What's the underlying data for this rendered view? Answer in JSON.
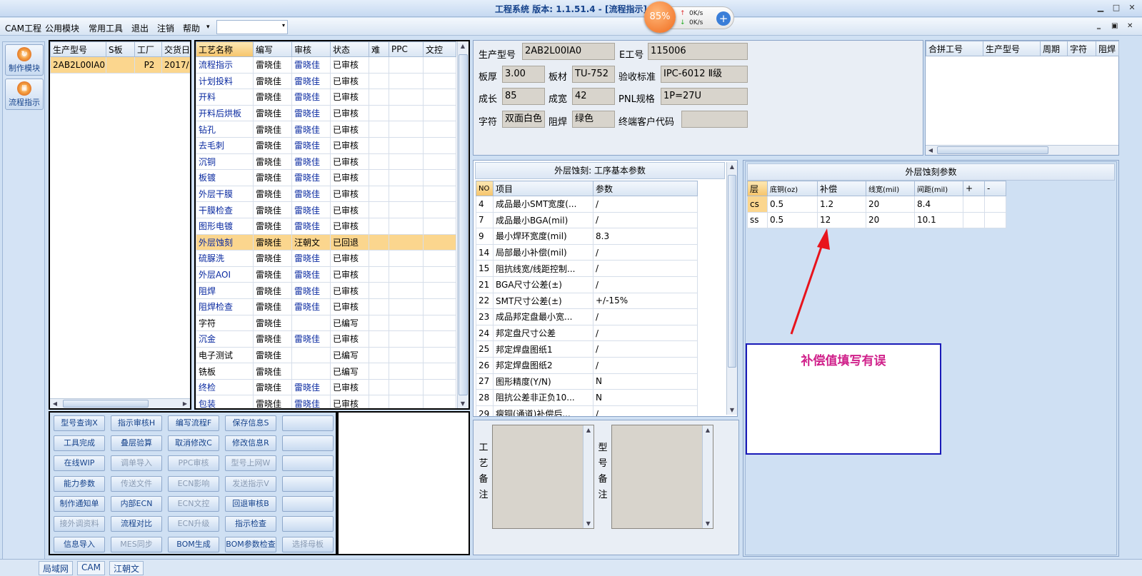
{
  "window": {
    "title": "工程系统  版本: 1.1.51.4 - [流程指示]",
    "minimize": "▁",
    "maximize": "□",
    "close": "✕"
  },
  "speed_widget": {
    "percent": "85%",
    "up_rate": "0K/s",
    "down_rate": "0K/s",
    "up_arrow": "↑",
    "down_arrow": "↓",
    "plus": "+"
  },
  "menu": {
    "items": [
      "CAM工程",
      "公用模块",
      "常用工具",
      "退出",
      "注销",
      "帮助"
    ],
    "help_arrow": "▾",
    "combo_value": "",
    "combo_arrow": "▾",
    "mdi_min": "‗",
    "mdi_restore": "▣",
    "mdi_close": "✕"
  },
  "sidebar": {
    "items": [
      {
        "label": "制作模块",
        "icon": "↻"
      },
      {
        "label": "流程指示",
        "icon": "Ⅲ"
      }
    ]
  },
  "product_table": {
    "headers": [
      "生产型号",
      "S板",
      "工厂",
      "交货日"
    ],
    "rows": [
      [
        "2AB2L00IA0",
        "",
        "P2",
        "2017/"
      ]
    ]
  },
  "process_table": {
    "headers": [
      "工艺名称",
      "编写",
      "审核",
      "状态",
      "难",
      "PPC",
      "文控"
    ],
    "rows": [
      [
        "流程指示",
        "雷晓佳",
        "雷晓佳",
        "已审核"
      ],
      [
        "计划投料",
        "雷晓佳",
        "雷晓佳",
        "已审核"
      ],
      [
        "开料",
        "雷晓佳",
        "雷晓佳",
        "已审核"
      ],
      [
        "开料后烘板",
        "雷晓佳",
        "雷晓佳",
        "已审核"
      ],
      [
        "钻孔",
        "雷晓佳",
        "雷晓佳",
        "已审核"
      ],
      [
        "去毛刺",
        "雷晓佳",
        "雷晓佳",
        "已审核"
      ],
      [
        "沉铜",
        "雷晓佳",
        "雷晓佳",
        "已审核"
      ],
      [
        "板镀",
        "雷晓佳",
        "雷晓佳",
        "已审核"
      ],
      [
        "外层干膜",
        "雷晓佳",
        "雷晓佳",
        "已审核"
      ],
      [
        "干膜检查",
        "雷晓佳",
        "雷晓佳",
        "已审核"
      ],
      [
        "图形电镀",
        "雷晓佳",
        "雷晓佳",
        "已审核"
      ],
      [
        "外层蚀刻",
        "雷晓佳",
        "汪朝文",
        "已回退"
      ],
      [
        "硫脲洗",
        "雷晓佳",
        "雷晓佳",
        "已审核"
      ],
      [
        "外层AOI",
        "雷晓佳",
        "雷晓佳",
        "已审核"
      ],
      [
        "阻焊",
        "雷晓佳",
        "雷晓佳",
        "已审核"
      ],
      [
        "阻焊检查",
        "雷晓佳",
        "雷晓佳",
        "已审核"
      ],
      [
        "字符",
        "雷晓佳",
        "",
        "已编写"
      ],
      [
        "沉金",
        "雷晓佳",
        "雷晓佳",
        "已审核"
      ],
      [
        "电子测试",
        "雷晓佳",
        "",
        "已编写"
      ],
      [
        "铣板",
        "雷晓佳",
        "",
        "已编写"
      ],
      [
        "终检",
        "雷晓佳",
        "雷晓佳",
        "已审核"
      ],
      [
        "包装",
        "雷晓佳",
        "雷晓佳",
        "已审核"
      ]
    ],
    "selected_index": 11
  },
  "action_buttons": [
    [
      {
        "label": "型号查询X",
        "enabled": true
      },
      {
        "label": "指示审核H",
        "enabled": true
      },
      {
        "label": "编写流程F",
        "enabled": true
      },
      {
        "label": "保存信息S",
        "enabled": true
      },
      {
        "label": "",
        "enabled": true
      }
    ],
    [
      {
        "label": "工具完成",
        "enabled": true
      },
      {
        "label": "叠层验算",
        "enabled": true
      },
      {
        "label": "取消修改C",
        "enabled": true
      },
      {
        "label": "修改信息R",
        "enabled": true
      },
      {
        "label": "",
        "enabled": true
      }
    ],
    [
      {
        "label": "在线WIP",
        "enabled": true
      },
      {
        "label": "调单导入",
        "enabled": false
      },
      {
        "label": "PPC审核",
        "enabled": false
      },
      {
        "label": "型号上网W",
        "enabled": false
      },
      {
        "label": "",
        "enabled": true
      }
    ],
    [
      {
        "label": "能力参数",
        "enabled": true
      },
      {
        "label": "传送文件",
        "enabled": false
      },
      {
        "label": "ECN影响",
        "enabled": false
      },
      {
        "label": "发送指示V",
        "enabled": false
      },
      {
        "label": "",
        "enabled": true
      }
    ],
    [
      {
        "label": "制作通知单",
        "enabled": true
      },
      {
        "label": "内部ECN",
        "enabled": true
      },
      {
        "label": "ECN文控",
        "enabled": false
      },
      {
        "label": "回退审核B",
        "enabled": true
      },
      {
        "label": "",
        "enabled": true
      }
    ],
    [
      {
        "label": "接外调资料",
        "enabled": false
      },
      {
        "label": "流程对比",
        "enabled": true
      },
      {
        "label": "ECN升级",
        "enabled": false
      },
      {
        "label": "指示检查",
        "enabled": true
      },
      {
        "label": "",
        "enabled": true
      }
    ],
    [
      {
        "label": "信息导入",
        "enabled": true
      },
      {
        "label": "MES同步",
        "enabled": false
      },
      {
        "label": "BOM生成",
        "enabled": true
      },
      {
        "label": "BOM参数检查",
        "enabled": true
      },
      {
        "label": "选择母板",
        "enabled": false
      }
    ]
  ],
  "info": {
    "model_label": "生产型号",
    "model_value": "2AB2L00IA0",
    "e_label": "E工号",
    "e_value": "115006",
    "thickness_label": "板厚",
    "thickness_value": "3.00",
    "material_label": "板材",
    "material_value": "TU-752",
    "accept_label": "验收标准",
    "accept_value": "IPC-6012 Ⅱ级",
    "length_label": "成长",
    "length_value": "85",
    "width_label": "成宽",
    "width_value": "42",
    "pnl_label": "PNL规格",
    "pnl_value": "1P=27U",
    "char_label": "字符",
    "char_value": "双面白色",
    "mask_label": "阻焊",
    "mask_value": "绿色",
    "customer_label": "终端客户代码",
    "customer_value": ""
  },
  "combo_table": {
    "headers": [
      "合拼工号",
      "生产型号",
      "周期",
      "字符",
      "阻焊"
    ]
  },
  "params": {
    "title": "外层蚀刻: 工序基本参数",
    "headers": [
      "NO",
      "项目",
      "参数"
    ],
    "rows": [
      [
        "4",
        "成品最小SMT宽度(...",
        "/"
      ],
      [
        "7",
        "成品最小BGA(mil)",
        "/"
      ],
      [
        "9",
        "最小焊环宽度(mil)",
        "8.3"
      ],
      [
        "14",
        "局部最小补偿(mil)",
        "/"
      ],
      [
        "15",
        "阻抗线宽/线距控制...",
        "/"
      ],
      [
        "21",
        "BGA尺寸公差(±)",
        "/"
      ],
      [
        "22",
        "SMT尺寸公差(±)",
        "+/-15%"
      ],
      [
        "23",
        "成品邦定盘最小宽...",
        "/"
      ],
      [
        "24",
        "邦定盘尺寸公差",
        "/"
      ],
      [
        "25",
        "邦定焊盘图纸1",
        "/"
      ],
      [
        "26",
        "邦定焊盘图纸2",
        "/"
      ],
      [
        "27",
        "图形精度(Y/N)",
        "N"
      ],
      [
        "28",
        "阻抗公差非正负10...",
        "N"
      ],
      [
        "29",
        "瘦铜(通道)补偿后...",
        "/"
      ]
    ]
  },
  "etch": {
    "title": "外层蚀刻参数",
    "headers": [
      "层",
      "底铜(oz)",
      "补偿",
      "线宽(mil)",
      "间距(mil)",
      "+",
      "-"
    ],
    "rows": [
      [
        "cs",
        "0.5",
        "1.2",
        "20",
        "8.4",
        "",
        ""
      ],
      [
        "ss",
        "0.5",
        "12",
        "20",
        "10.1",
        "",
        ""
      ]
    ]
  },
  "notes": {
    "process_label": "工艺备注",
    "model_label": "型号备注"
  },
  "annotation": {
    "text": "补偿值填写有误",
    "arrow_color": "#e8141c"
  },
  "status_tabs": [
    "局域网",
    "CAM",
    "江朝文"
  ]
}
